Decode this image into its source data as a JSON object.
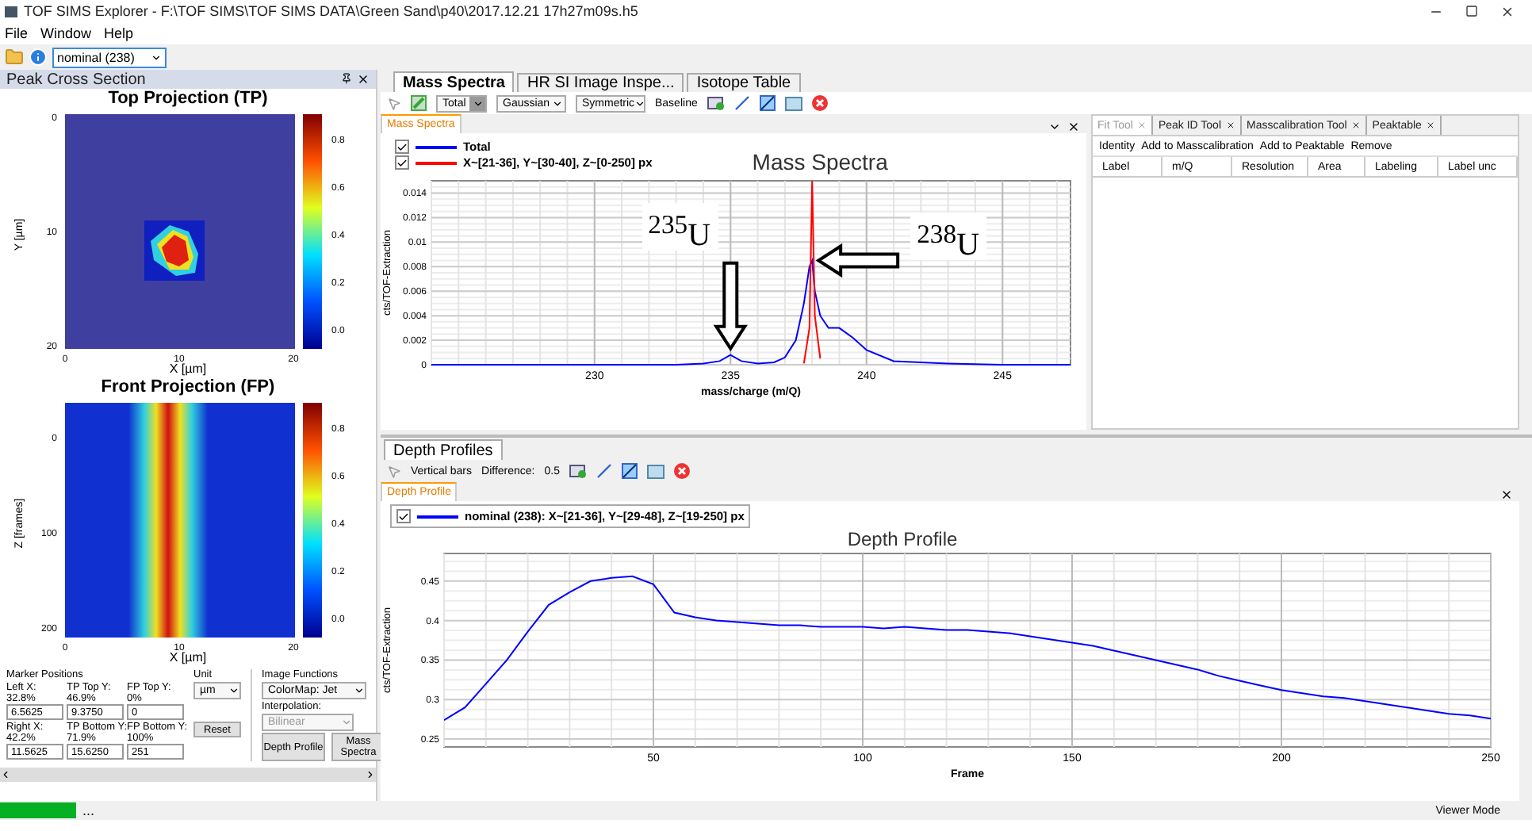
{
  "window": {
    "title": "TOF SIMS Explorer - F:\\TOF SIMS\\TOF SIMS DATA\\Green Sand\\p40\\2017.12.21 17h27m09s.h5"
  },
  "menu": [
    "File",
    "Window",
    "Help"
  ],
  "toolbar": {
    "dataset": "nominal (238)"
  },
  "left_panel": {
    "title": "Peak Cross Section",
    "projections": [
      {
        "kind": "top",
        "title": "Top Projection (TP)",
        "ylabel": "Y [µm]",
        "xlabel": "X [µm]",
        "yticks": [
          "0",
          "10",
          "20"
        ],
        "xticks": [
          "0",
          "10",
          "20"
        ],
        "colorbar_ticks": [
          "0.8",
          "0.6",
          "0.4",
          "0.2",
          "0.0"
        ]
      },
      {
        "kind": "front",
        "title": "Front Projection (FP)",
        "ylabel": "Z [frames]",
        "xlabel": "X [µm]",
        "yticks": [
          "0",
          "100",
          "200"
        ],
        "xticks": [
          "0",
          "10",
          "20"
        ],
        "colorbar_ticks": [
          "0.8",
          "0.6",
          "0.4",
          "0.2",
          "0.0"
        ]
      }
    ],
    "marker_positions": {
      "title": "Marker Positions",
      "rows": [
        [
          {
            "label": "Left X:",
            "percent": "32.8%",
            "value": "6.5625"
          },
          {
            "label": "TP Top Y:",
            "percent": "46.9%",
            "value": "9.3750"
          },
          {
            "label": "FP Top Y:",
            "percent": "0%",
            "value": "0"
          }
        ],
        [
          {
            "label": "Right X:",
            "percent": "42.2%",
            "value": "11.5625"
          },
          {
            "label": "TP Bottom Y:",
            "percent": "71.9%",
            "value": "15.6250"
          },
          {
            "label": "FP Bottom Y:",
            "percent": "100%",
            "value": "251"
          }
        ]
      ]
    },
    "unit": {
      "label": "Unit",
      "value": "µm"
    },
    "reset": "Reset",
    "image_functions": {
      "title": "Image Functions",
      "colormap": "ColorMap: Jet",
      "interpolation_label": "Interpolation:",
      "interpolation": "Bilinear",
      "buttons": [
        "Depth Profile",
        "Mass Spectra"
      ]
    }
  },
  "main_tabs": [
    {
      "label": "Mass Spectra",
      "selected": true
    },
    {
      "label": "HR SI Image Inspe...",
      "selected": false
    },
    {
      "label": "Isotope Table",
      "selected": false
    }
  ],
  "mass_toolbar": {
    "dropdowns": [
      "Total",
      "Gaussian",
      "Symmetric"
    ],
    "baseline": "Baseline"
  },
  "mass_panel": {
    "tab": "Mass Spectra",
    "legend": [
      {
        "checked": true
      },
      {
        "checked": true
      }
    ],
    "chart_data": {
      "type": "line",
      "title": "Mass Spectra",
      "xlabel": "mass/charge (m/Q)",
      "ylabel": "cts/TOF-Extraction",
      "xlim": [
        224,
        247.5
      ],
      "ylim": [
        0,
        0.015
      ],
      "grid": true,
      "xticks": [
        230,
        235,
        240,
        245
      ],
      "yticks": [
        0,
        0.002,
        0.004,
        0.006,
        0.008,
        0.01,
        0.012,
        0.014
      ],
      "x": [
        224,
        226,
        228,
        230,
        232,
        233,
        234,
        234.6,
        235,
        235.4,
        236,
        236.6,
        237,
        237.4,
        237.7,
        237.9,
        238,
        238.1,
        238.3,
        238.6,
        239,
        239.5,
        240,
        241,
        243,
        245,
        247.5
      ],
      "series": [
        {
          "name": "Total",
          "color": "#0000ff",
          "values": [
            0,
            0,
            0,
            0,
            0,
            0,
            0.0001,
            0.0003,
            0.0008,
            0.0003,
            0.0001,
            0.0002,
            0.0006,
            0.002,
            0.005,
            0.008,
            0.0085,
            0.006,
            0.004,
            0.003,
            0.003,
            0.0022,
            0.0012,
            0.0003,
            0.0001,
            0,
            0
          ]
        },
        {
          "name": "X~[21-36], Y~[30-40], Z~[0-250] px",
          "color": "#ff0000",
          "values": [
            null,
            null,
            null,
            null,
            null,
            null,
            null,
            null,
            null,
            null,
            null,
            null,
            null,
            null,
            0.0001,
            0.003,
            0.015,
            0.004,
            0.0005,
            null,
            null,
            null,
            null,
            null,
            null,
            null,
            null
          ]
        }
      ],
      "annotations": [
        "$^{235}$U",
        "$^{238}$U"
      ]
    }
  },
  "tool_tabs": [
    {
      "label": "Fit Tool",
      "selected": true
    },
    {
      "label": "Peak ID Tool",
      "selected": false
    },
    {
      "label": "Masscalibration Tool",
      "selected": false
    },
    {
      "label": "Peaktable",
      "selected": false
    }
  ],
  "tool_actions": [
    "Identity",
    "Add to Masscalibration",
    "Add to Peaktable",
    "Remove"
  ],
  "peak_table": {
    "columns": [
      "Label",
      "m/Q",
      "Resolution",
      "Area",
      "Labeling",
      "Label unc"
    ]
  },
  "depth_tabs": [
    {
      "label": "Depth Profiles",
      "selected": true
    }
  ],
  "depth_toolbar": {
    "vertical_bars": "Vertical bars",
    "difference_label": "Difference:",
    "difference": "0.5"
  },
  "depth_panel": {
    "tab": "Depth Profile",
    "legend": [
      {
        "checked": true
      }
    ],
    "chart_data": {
      "type": "line",
      "title": "Depth Profile",
      "xlabel": "Frame",
      "ylabel": "cts/TOF-Extraction",
      "xlim": [
        0,
        250
      ],
      "ylim": [
        0.24,
        0.485
      ],
      "grid": true,
      "xticks": [
        50,
        100,
        150,
        200,
        250
      ],
      "yticks": [
        0.25,
        0.3,
        0.35,
        0.4,
        0.45
      ],
      "x": [
        0,
        5,
        10,
        15,
        20,
        25,
        30,
        35,
        40,
        45,
        50,
        55,
        60,
        65,
        70,
        75,
        80,
        85,
        90,
        95,
        100,
        105,
        110,
        115,
        120,
        125,
        130,
        135,
        140,
        145,
        150,
        155,
        160,
        165,
        170,
        175,
        180,
        185,
        190,
        195,
        200,
        205,
        210,
        215,
        220,
        225,
        230,
        235,
        240,
        245,
        250
      ],
      "series": [
        {
          "name": "nominal (238): X~[21-36], Y~[29-48], Z~[19-250] px",
          "color": "#0000ff",
          "values": [
            0.274,
            0.29,
            0.32,
            0.35,
            0.386,
            0.42,
            0.436,
            0.45,
            0.454,
            0.456,
            0.446,
            0.41,
            0.404,
            0.4,
            0.398,
            0.396,
            0.394,
            0.394,
            0.392,
            0.392,
            0.392,
            0.39,
            0.392,
            0.39,
            0.388,
            0.388,
            0.386,
            0.384,
            0.38,
            0.376,
            0.372,
            0.368,
            0.362,
            0.356,
            0.35,
            0.344,
            0.338,
            0.33,
            0.324,
            0.318,
            0.312,
            0.308,
            0.304,
            0.302,
            0.298,
            0.294,
            0.29,
            0.286,
            0.282,
            0.28,
            0.276
          ]
        }
      ]
    }
  },
  "status_bar": {
    "progress": {
      "level": 1
    },
    "text": "...",
    "mode": "Viewer Mode"
  }
}
